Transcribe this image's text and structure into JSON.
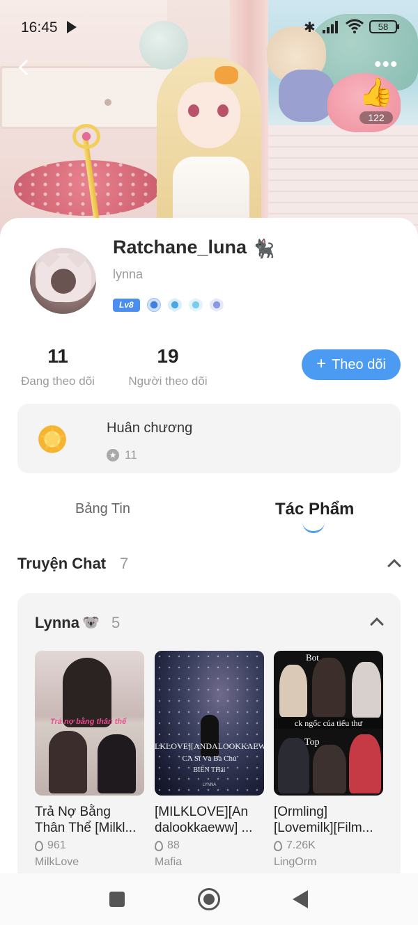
{
  "status_bar": {
    "time": "16:45",
    "battery": "58"
  },
  "header": {
    "like_count": "122"
  },
  "profile": {
    "username": "Ratchane_luna",
    "handle": "lynna",
    "level": "Lv8",
    "following_count": "11",
    "following_label": "Đang theo dõi",
    "followers_count": "19",
    "followers_label": "Người theo dõi",
    "follow_button": "Theo dõi"
  },
  "medals": {
    "title": "Huân chương",
    "count": "11"
  },
  "tabs": [
    {
      "label": "Bảng Tin",
      "active": false
    },
    {
      "label": "Tác Phẩm",
      "active": true
    }
  ],
  "section": {
    "title": "Truyện Chat",
    "count": "7"
  },
  "group": {
    "title": "Lynna",
    "count": "5",
    "stories": [
      {
        "title": "Trả Nợ Bằng Thân Thể [Milkl...",
        "views": "961",
        "category": "MilkLove",
        "cover_text": "Trả nợ bằng thân thể"
      },
      {
        "title": "[MILKLOVE][An dalookkaeww] ...",
        "views": "88",
        "category": "Mafia",
        "cover_text": [
          "LKLOVE][ANDALOOKKAEW",
          "CA Sĩ Và Bà Chủ",
          "BIẾN THái",
          "LYNNA"
        ]
      },
      {
        "title": "[Ormling] [Lovemilk][Film...",
        "views": "7.26K",
        "category": "LingOrm",
        "cover_text": [
          "Bot",
          "ck ngốc của tiểu thư",
          "Top"
        ]
      }
    ]
  },
  "colors": {
    "accent": "#4c9bf2",
    "card_bg": "#f4f4f4",
    "muted": "#9b9b9b"
  }
}
